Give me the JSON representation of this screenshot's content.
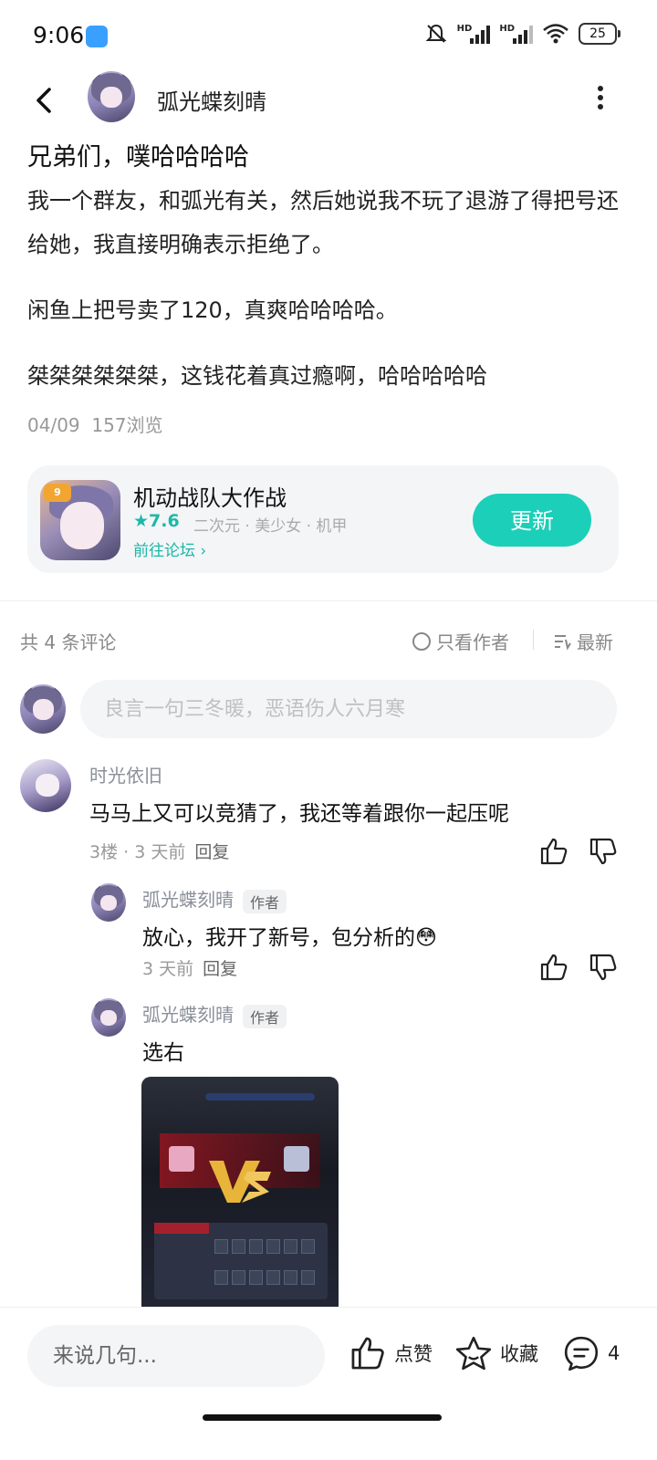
{
  "status_bar": {
    "time": "9:06",
    "battery": "25"
  },
  "header": {
    "author_name": "弧光蝶刻晴"
  },
  "post": {
    "title": "兄弟们，噗哈哈哈哈",
    "paragraphs": [
      "我一个群友，和弧光有关，然后她说我不玩了退游了得把号还给她，我直接明确表示拒绝了。",
      "闲鱼上把号卖了120，真爽哈哈哈哈。",
      "桀桀桀桀桀桀，这钱花着真过瘾啊，哈哈哈哈哈"
    ],
    "date": "04/09",
    "views": "157浏览"
  },
  "game_card": {
    "name": "机动战队大作战",
    "rating": "★7.6",
    "tags": "二次元 · 美少女 · 机甲",
    "forum_link": "前往论坛 ›",
    "update_label": "更新"
  },
  "comments_header": {
    "count_label": "共 4 条评论",
    "author_only_label": "只看作者",
    "sort_label": "最新"
  },
  "comment_input": {
    "placeholder": "良言一句三冬暖，恶语伤人六月寒"
  },
  "comments": [
    {
      "author": "时光依旧",
      "text": "马马上又可以竞猜了，我还等着跟你一起压呢",
      "floor": "3楼",
      "time": "3 天前",
      "reply_label": "回复"
    }
  ],
  "replies": [
    {
      "author": "弧光蝶刻晴",
      "author_tag": "作者",
      "text": "放心，我开了新号，包分析的😳",
      "time": "3 天前",
      "reply_label": "回复"
    },
    {
      "author": "弧光蝶刻晴",
      "author_tag": "作者",
      "text": "选右"
    }
  ],
  "bottom_bar": {
    "input_placeholder": "来说几句...",
    "like_label": "点赞",
    "favorite_label": "收藏",
    "comment_count": "4"
  },
  "colors": {
    "accent": "#1ccfb8",
    "link": "#1cb8a8",
    "card_bg": "#f3f5f7"
  },
  "icons": [
    "back-arrow-icon",
    "more-icon",
    "like-icon",
    "dislike-icon",
    "star-icon",
    "comment-icon",
    "wifi-icon",
    "signal-icon",
    "mute-icon"
  ]
}
